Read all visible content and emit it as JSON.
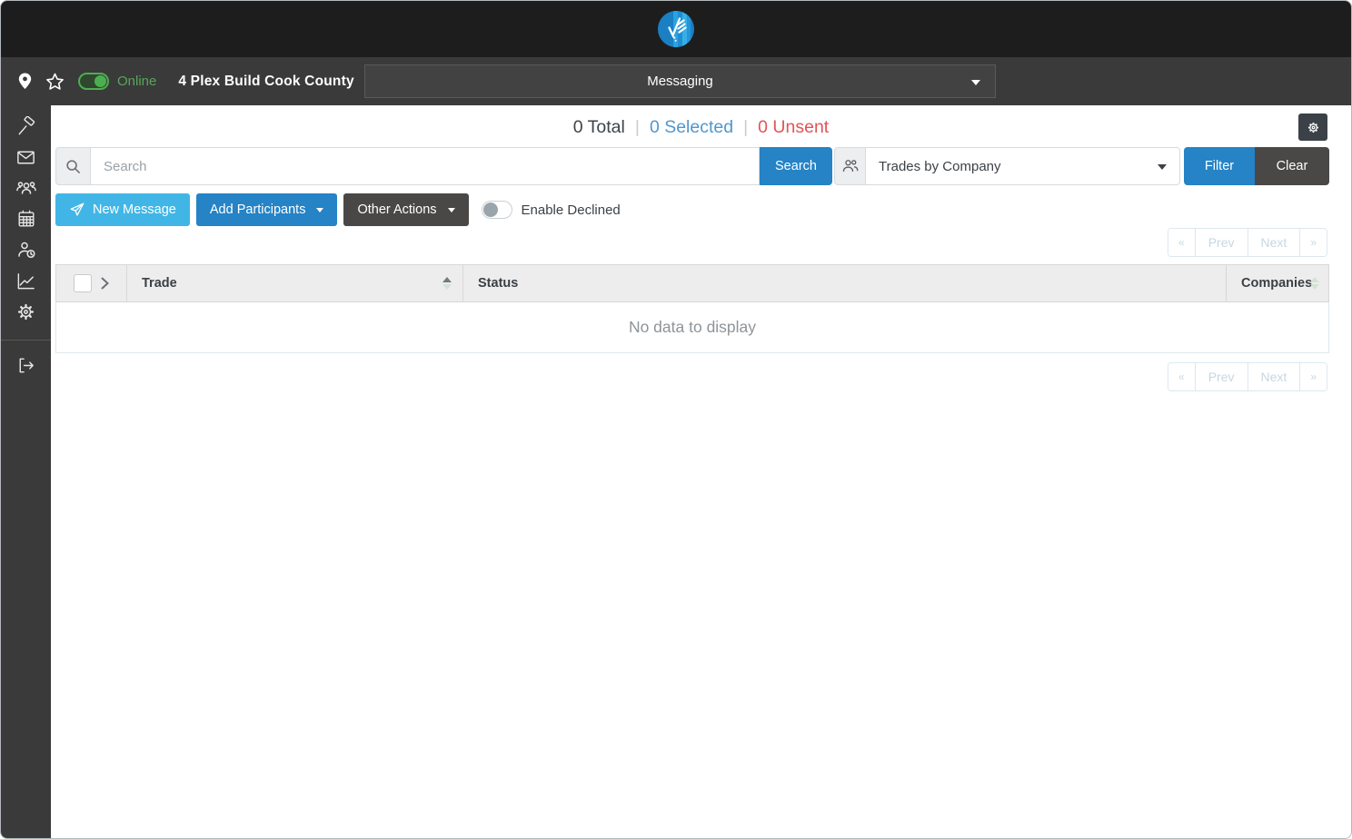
{
  "colors": {
    "topbar_bg": "#1d1d1d",
    "bar_bg": "#3a3a3a",
    "accent_blue": "#2583c6",
    "light_blue": "#41b6e6",
    "dark_button": "#4a4847",
    "online_green": "#57a65a",
    "selected_blue": "#4f97cd",
    "unsent_red": "#e25357",
    "logo_blue": "#1f8fd0"
  },
  "topbar": {
    "logo_icon": "buildingconnected-logo"
  },
  "projectbar": {
    "pin_icon": "map-pin-icon",
    "star_icon": "star-icon",
    "online_toggle_state": "on",
    "online_label": "Online",
    "project_name": "4 Plex Build Cook County",
    "nav_selected": "Messaging",
    "caret_icon": "caret-down-icon"
  },
  "sidebar": {
    "icons": [
      "hammer-icon",
      "mail-icon",
      "people-group-icon",
      "calendar-icon",
      "person-clock-icon",
      "line-chart-icon",
      "gear-icon",
      "logout-icon"
    ]
  },
  "counts": {
    "total": "0 Total",
    "separator": "|",
    "selected": "0 Selected",
    "unsent": "0 Unsent"
  },
  "toolbar": {
    "settings_icon": "gear-icon"
  },
  "search": {
    "search_icon": "search-icon",
    "placeholder": "Search",
    "value": "",
    "search_button": "Search",
    "people_icon": "people-duo-icon",
    "group_by_value": "Trades by Company",
    "filter_button": "Filter",
    "clear_button": "Clear"
  },
  "actions": {
    "new_message": "New Message",
    "send_icon": "paper-plane-icon",
    "add_participants": "Add Participants",
    "other_actions": "Other Actions",
    "enable_declined_label": "Enable Declined",
    "enable_declined_state": "off"
  },
  "pagination": {
    "first": "«",
    "prev": "Prev",
    "next": "Next",
    "last": "»"
  },
  "table": {
    "columns": {
      "trade": "Trade",
      "status": "Status",
      "companies": "Companies"
    },
    "sort": {
      "trade": "ascending"
    },
    "empty_message": "No data to display"
  }
}
